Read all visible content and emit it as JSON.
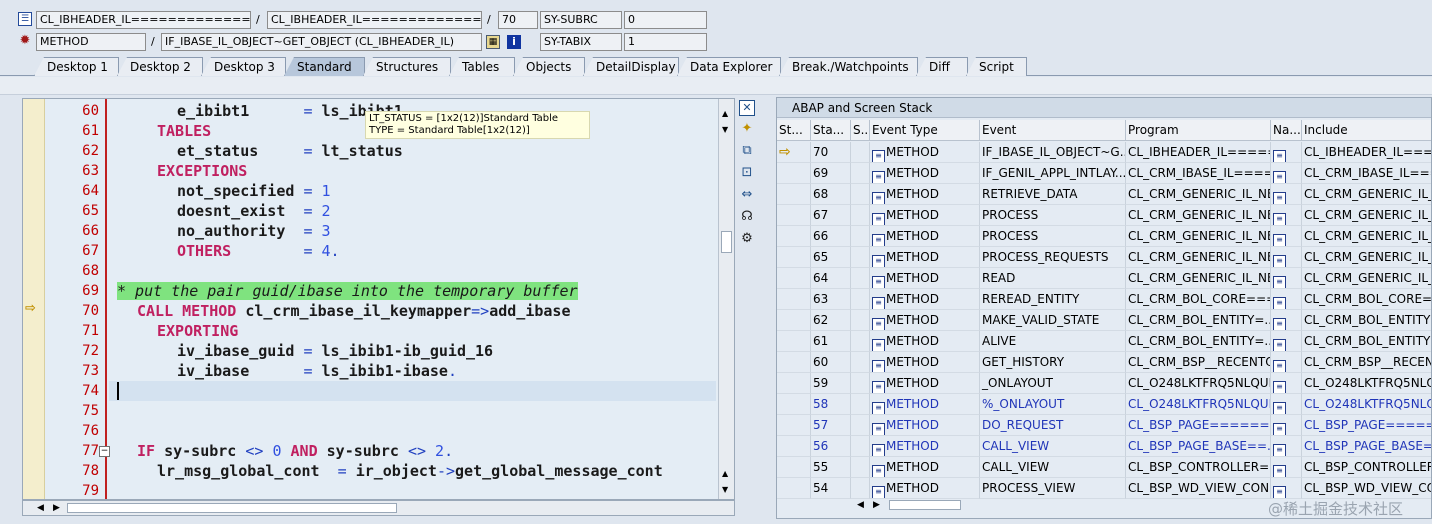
{
  "header": {
    "row1": {
      "field1": "CL_IBHEADER_IL===============...",
      "sep1": "/",
      "field2": "CL_IBHEADER_IL===============...",
      "sep2": "/",
      "line": "70",
      "var": "SY-SUBRC",
      "value": "0"
    },
    "row2": {
      "type": "METHOD",
      "sep": "/",
      "event": "IF_IBASE_IL_OBJECT~GET_OBJECT (CL_IBHEADER_IL)",
      "info": "i",
      "var": "SY-TABIX",
      "value": "1"
    }
  },
  "tabs": [
    "Desktop 1",
    "Desktop 2",
    "Desktop 3",
    "Standard",
    "Structures",
    "Tables",
    "Objects",
    "DetailDisplay",
    "Data Explorer",
    "Break./Watchpoints",
    "Diff",
    "Script"
  ],
  "active_tab": "Standard",
  "editor": {
    "line_numbers": [
      "60",
      "61",
      "62",
      "63",
      "64",
      "65",
      "66",
      "67",
      "68",
      "69",
      "70",
      "71",
      "72",
      "73",
      "74",
      "75",
      "76",
      "77",
      "78",
      "79"
    ],
    "current_line_marker": "⇨",
    "fold_marker": "−",
    "tooltip": {
      "line1": "LT_STATUS = [1x2(12)]Standard Table",
      "line2": "TYPE  = Standard Table[1x2(12)]"
    }
  },
  "code": {
    "l60": {
      "a": "e_ibibt1",
      "b": "=",
      "c": "ls_ibibt1"
    },
    "l61": {
      "kw": "TABLES"
    },
    "l62": {
      "a": "et_status",
      "b": "=",
      "c": "lt_status"
    },
    "l63": {
      "kw": "EXCEPTIONS"
    },
    "l64": {
      "a": "not_specified",
      "b": "=",
      "n": "1"
    },
    "l65": {
      "a": "doesnt_exist",
      "b": "=",
      "n": "2"
    },
    "l66": {
      "a": "no_authority",
      "b": "=",
      "n": "3"
    },
    "l67": {
      "kw": "OTHERS",
      "b": "=",
      "n": "4",
      "d": "."
    },
    "l69": {
      "cmt": "* put the pair guid/ibase into the temporary buffer"
    },
    "l70": {
      "kw": "CALL METHOD",
      "a": "cl_crm_ibase_il_keymapper",
      "op": "=>",
      "c": "add_ibase"
    },
    "l71": {
      "kw": "EXPORTING"
    },
    "l72": {
      "a": "iv_ibase_guid",
      "b": "=",
      "c": "ls_ibib1-ib_guid_16"
    },
    "l73": {
      "a": "iv_ibase",
      "b": "=",
      "c": "ls_ibib1-ibase",
      "d": "."
    },
    "l77": {
      "kw1": "IF",
      "a": "sy-subrc",
      "op1": "<>",
      "n1": "0",
      "kw2": "AND",
      "c": "sy-subrc",
      "op2": "<>",
      "n2": "2",
      "d": "."
    },
    "l78": {
      "a": "lr_msg_global_cont",
      "b": "=",
      "c": "ir_object",
      "op": "->",
      "e": "get_global_message_cont"
    }
  },
  "sidebar_icons": [
    "close-icon",
    "new-icon",
    "copy-icon",
    "expand-icon",
    "resize-icon",
    "headset-icon",
    "tree-icon"
  ],
  "stack": {
    "title": "ABAP and Screen Stack",
    "headers": [
      "St...",
      "Sta...",
      "S...",
      "Event Type",
      "Event",
      "Program",
      "Na...",
      "Include"
    ],
    "current_marker": "⇨",
    "rows": [
      {
        "level": "70",
        "type": "METHOD",
        "event": "IF_IBASE_IL_OBJECT~G...",
        "program": "CL_IBHEADER_IL=====...",
        "include": "CL_IBHEADER_IL====",
        "current": true,
        "blue": false
      },
      {
        "level": "69",
        "type": "METHOD",
        "event": "IF_GENIL_APPL_INTLAY...",
        "program": "CL_CRM_IBASE_IL====...",
        "include": "CL_CRM_IBASE_IL====",
        "current": false,
        "blue": false
      },
      {
        "level": "68",
        "type": "METHOD",
        "event": "RETRIEVE_DATA",
        "program": "CL_CRM_GENERIC_IL_NE...",
        "include": "CL_CRM_GENERIC_IL_N",
        "current": false,
        "blue": false
      },
      {
        "level": "67",
        "type": "METHOD",
        "event": "PROCESS",
        "program": "CL_CRM_GENERIC_IL_NE...",
        "include": "CL_CRM_GENERIC_IL_N",
        "current": false,
        "blue": false
      },
      {
        "level": "66",
        "type": "METHOD",
        "event": "PROCESS",
        "program": "CL_CRM_GENERIC_IL_NE...",
        "include": "CL_CRM_GENERIC_IL_N",
        "current": false,
        "blue": false
      },
      {
        "level": "65",
        "type": "METHOD",
        "event": "PROCESS_REQUESTS",
        "program": "CL_CRM_GENERIC_IL_NE...",
        "include": "CL_CRM_GENERIC_IL_N",
        "current": false,
        "blue": false
      },
      {
        "level": "64",
        "type": "METHOD",
        "event": "READ",
        "program": "CL_CRM_GENERIC_IL_NE...",
        "include": "CL_CRM_GENERIC_IL_N",
        "current": false,
        "blue": false
      },
      {
        "level": "63",
        "type": "METHOD",
        "event": "REREAD_ENTITY",
        "program": "CL_CRM_BOL_CORE===...",
        "include": "CL_CRM_BOL_CORE====",
        "current": false,
        "blue": false
      },
      {
        "level": "62",
        "type": "METHOD",
        "event": "MAKE_VALID_STATE",
        "program": "CL_CRM_BOL_ENTITY=...",
        "include": "CL_CRM_BOL_ENTITY==",
        "current": false,
        "blue": false
      },
      {
        "level": "61",
        "type": "METHOD",
        "event": "ALIVE",
        "program": "CL_CRM_BOL_ENTITY=...",
        "include": "CL_CRM_BOL_ENTITY==",
        "current": false,
        "blue": false
      },
      {
        "level": "60",
        "type": "METHOD",
        "event": "GET_HISTORY",
        "program": "CL_CRM_BSP__RECENTO...",
        "include": "CL_CRM_BSP__RECENT",
        "current": false,
        "blue": false
      },
      {
        "level": "59",
        "type": "METHOD",
        "event": "_ONLAYOUT",
        "program": "CL_O248LKTFRQ5NLQUR...",
        "include": "CL_O248LKTFRQ5NLQU",
        "current": false,
        "blue": false
      },
      {
        "level": "58",
        "type": "METHOD",
        "event": "%_ONLAYOUT",
        "program": "CL_O248LKTFRQ5NLQUR...",
        "include": "CL_O248LKTFRQ5NLQU",
        "current": false,
        "blue": true
      },
      {
        "level": "57",
        "type": "METHOD",
        "event": "DO_REQUEST",
        "program": "CL_BSP_PAGE======...",
        "include": "CL_BSP_PAGE=======",
        "current": false,
        "blue": true
      },
      {
        "level": "56",
        "type": "METHOD",
        "event": "CALL_VIEW",
        "program": "CL_BSP_PAGE_BASE==...",
        "include": "CL_BSP_PAGE_BASE==",
        "current": false,
        "blue": true
      },
      {
        "level": "55",
        "type": "METHOD",
        "event": "CALL_VIEW",
        "program": "CL_BSP_CONTROLLER=...",
        "include": "CL_BSP_CONTROLLER=",
        "current": false,
        "blue": false
      },
      {
        "level": "54",
        "type": "METHOD",
        "event": "PROCESS_VIEW",
        "program": "CL_BSP_WD_VIEW_CON...",
        "include": "CL_BSP_WD_VIEW_CON",
        "current": false,
        "blue": false
      }
    ]
  },
  "watermark": "@稀土掘金技术社区"
}
